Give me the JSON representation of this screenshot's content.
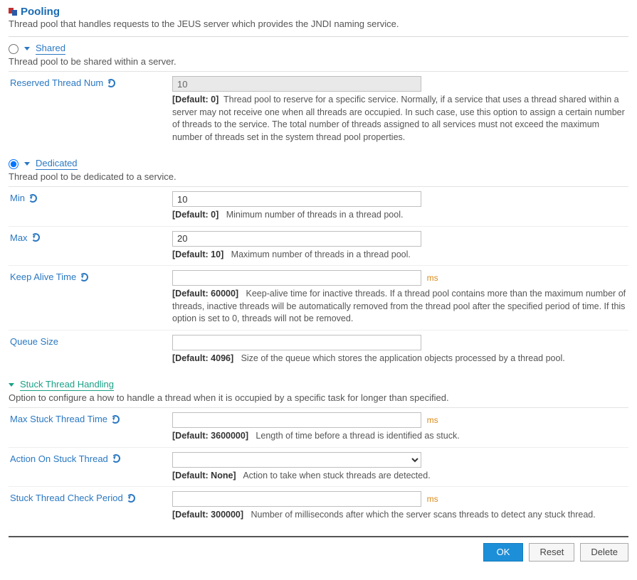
{
  "header": {
    "title": "Pooling",
    "desc": "Thread pool that handles requests to the JEUS server which provides the JNDI naming service."
  },
  "shared": {
    "title": "Shared",
    "desc": "Thread pool to be shared within a server.",
    "reserved": {
      "label": "Reserved Thread Num",
      "value": "10",
      "default": "[Default: 0]",
      "help": "Thread pool to reserve for a specific service. Normally, if a service that uses a thread shared within a server may not receive one when all threads are occupied. In such case, use this option to assign a certain number of threads to the service. The total number of threads assigned to all services must not exceed the maximum number of threads set in the system thread pool properties."
    }
  },
  "dedicated": {
    "title": "Dedicated",
    "desc": "Thread pool to be dedicated to a service.",
    "min": {
      "label": "Min",
      "value": "10",
      "default": "[Default: 0]",
      "help": "Minimum number of threads in a thread pool."
    },
    "max": {
      "label": "Max",
      "value": "20",
      "default": "[Default: 10]",
      "help": "Maximum number of threads in a thread pool."
    },
    "keepalive": {
      "label": "Keep Alive Time",
      "value": "",
      "unit": "ms",
      "default": "[Default: 60000]",
      "help": "Keep-alive time for inactive threads. If a thread pool contains more than the maximum number of threads, inactive threads will be automatically removed from the thread pool after the specified period of time. If this option is set to 0, threads will not be removed."
    },
    "queue": {
      "label": "Queue Size",
      "value": "",
      "default": "[Default: 4096]",
      "help": "Size of the queue which stores the application objects processed by a thread pool."
    }
  },
  "stuck": {
    "title": "Stuck Thread Handling",
    "desc": "Option to configure a how to handle a thread when it is occupied by a specific task for longer than specified.",
    "maxtime": {
      "label": "Max Stuck Thread Time",
      "value": "",
      "unit": "ms",
      "default": "[Default: 3600000]",
      "help": "Length of time before a thread is identified as stuck."
    },
    "action": {
      "label": "Action On Stuck Thread",
      "value": "",
      "default": "[Default: None]",
      "help": "Action to take when stuck threads are detected."
    },
    "check": {
      "label": "Stuck Thread Check Period",
      "value": "",
      "unit": "ms",
      "default": "[Default: 300000]",
      "help": "Number of milliseconds after which the server scans threads to detect any stuck thread."
    }
  },
  "buttons": {
    "ok": "OK",
    "reset": "Reset",
    "delete": "Delete"
  }
}
